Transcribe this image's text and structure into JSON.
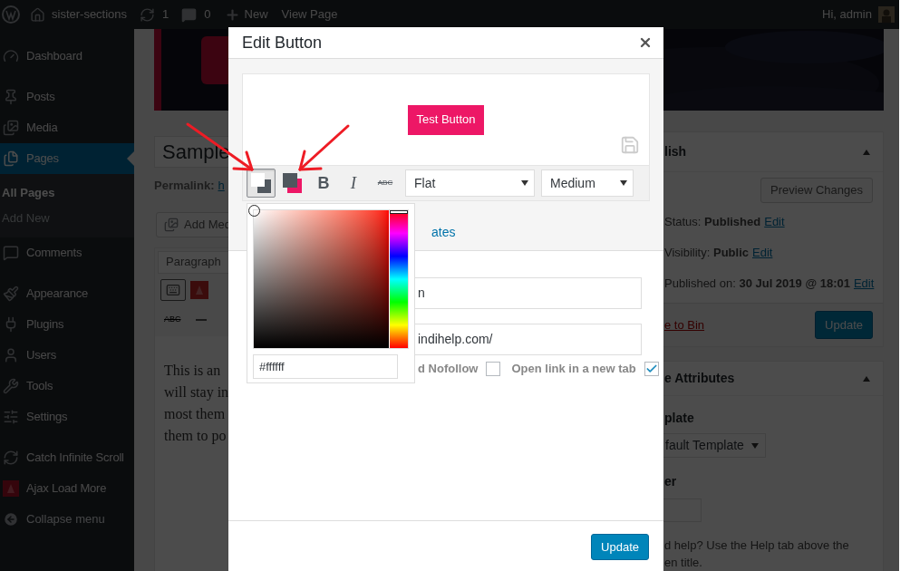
{
  "admin_bar": {
    "site": "sister-sections",
    "updates": "1",
    "comments": "0",
    "new": "New",
    "view": "View Page",
    "greeting": "Hi, admin"
  },
  "sidebar": {
    "groups": [
      [
        {
          "label": "Dashboard",
          "selected": false
        }
      ],
      [
        {
          "label": "Posts",
          "selected": false
        },
        {
          "label": "Media",
          "selected": false
        },
        {
          "label": "Pages",
          "selected": true,
          "children": [
            {
              "label": "All Pages",
              "selected": true
            },
            {
              "label": "Add New",
              "selected": false
            }
          ]
        },
        {
          "label": "Comments",
          "selected": false
        }
      ],
      [
        {
          "label": "Appearance",
          "selected": false
        },
        {
          "label": "Plugins",
          "selected": false
        },
        {
          "label": "Users",
          "selected": false
        },
        {
          "label": "Tools",
          "selected": false
        },
        {
          "label": "Settings",
          "selected": false
        }
      ],
      [
        {
          "label": "Catch Infinite Scroll",
          "selected": false
        },
        {
          "label": "Ajax Load More",
          "selected": false
        }
      ]
    ],
    "collapse": "Collapse menu"
  },
  "editor": {
    "title": "Sample",
    "permalink_label": "Permalink:",
    "permalink_link": "h",
    "add_media": "Add Med",
    "format": "Paragraph",
    "strike": "ABC",
    "content_lines": [
      "This is an",
      "will stay in",
      "most them",
      "them to po"
    ]
  },
  "publish": {
    "title": "lish",
    "preview": "Preview Changes",
    "rows": [
      {
        "label": "Status:",
        "value": "Published",
        "link": "Edit"
      },
      {
        "label": "Visibility:",
        "value": "Public",
        "link": "Edit"
      },
      {
        "label": "Published on:",
        "value": "30 Jul 2019 @ 18:01",
        "link": "Edit"
      }
    ],
    "trash": "e to Bin",
    "update": "Update"
  },
  "page_attributes": {
    "title": "e Attributes",
    "template_label": "plate",
    "template_value": "fault Template",
    "order_label": "er",
    "help_lines": [
      "d help? Use the Help tab above the",
      "en title."
    ]
  },
  "modal": {
    "title": "Edit Button",
    "preview_button": "Test Button",
    "toolbar": [
      {
        "kind": "background-color",
        "selected": true
      },
      {
        "kind": "text-color",
        "selected": false
      },
      {
        "kind": "bold",
        "label": "B",
        "selected": false
      },
      {
        "kind": "italic",
        "label": "I",
        "selected": false
      },
      {
        "kind": "strikethrough",
        "label": "ABC",
        "selected": false
      }
    ],
    "style_select": "Flat",
    "size_select": "Medium",
    "tab_link": "ates",
    "fields": [
      {
        "value": "n"
      },
      {
        "value": "indihelp.com/"
      }
    ],
    "options": [
      {
        "label": "d Nofollow",
        "checked": false
      },
      {
        "label": "Open link in a new tab",
        "checked": true
      }
    ],
    "color_picker": {
      "hex": "#ffffff",
      "hue_slider": {
        "level": 0
      }
    },
    "update": "Update"
  }
}
